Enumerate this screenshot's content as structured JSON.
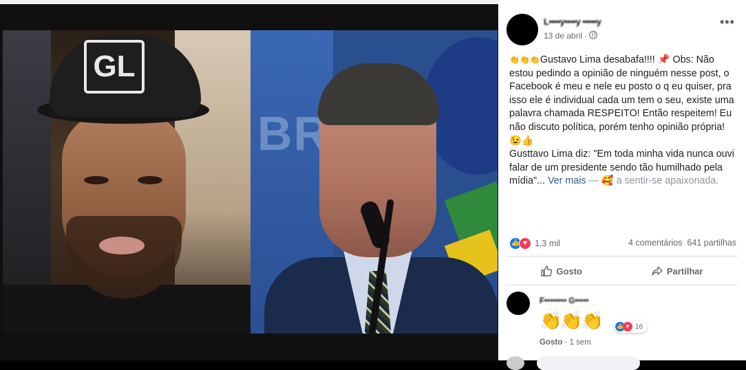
{
  "post": {
    "author": "L••••y••••y •••••y",
    "date": "13 de abril",
    "more": "•••",
    "text_line1_prefix": "👏👏👏",
    "text_body": "Gustavo Lima desabafa!!!! ",
    "pin": "📌",
    "text_body2": " Obs: Não estou pedindo a opinião de ninguém nesse post, o Facebook é meu e nele eu posto o q eu quiser, pra isso ele é individual cada um tem o seu, existe uma palavra chamada RESPEITO! Então respeitem! Eu não discuto política, porém tenho opinião própria!",
    "text_emoji_line": "😉👍",
    "quote": "Gusttavo Lima diz: \"Em toda minha vida nunca ouvi falar de um presidente sendo tão humilhado pela mídia\"...",
    "see_more": "Ver mais",
    "feeling_dash": " — ",
    "feeling_emoji": "🥰",
    "feeling_text": " a sentir-se apaixonada."
  },
  "reactions": {
    "count": "1,3 mil",
    "comments": "4 comentários",
    "shares": "641 partilhas"
  },
  "actions": {
    "like_label": "Gosto",
    "share_label": "Partilhar"
  },
  "comment": {
    "author": "F•••••••• G•••••",
    "claps": "👏👏👏",
    "react_count": "16",
    "like_link": "Gosto",
    "time": " · 1 sem"
  },
  "photo": {
    "cap_logo": "GL",
    "background_text": "BRA"
  },
  "colors": {
    "link": "#385898",
    "secondary_text": "#65676b",
    "like_blue": "#1877f2",
    "love_red": "#f33e58"
  }
}
